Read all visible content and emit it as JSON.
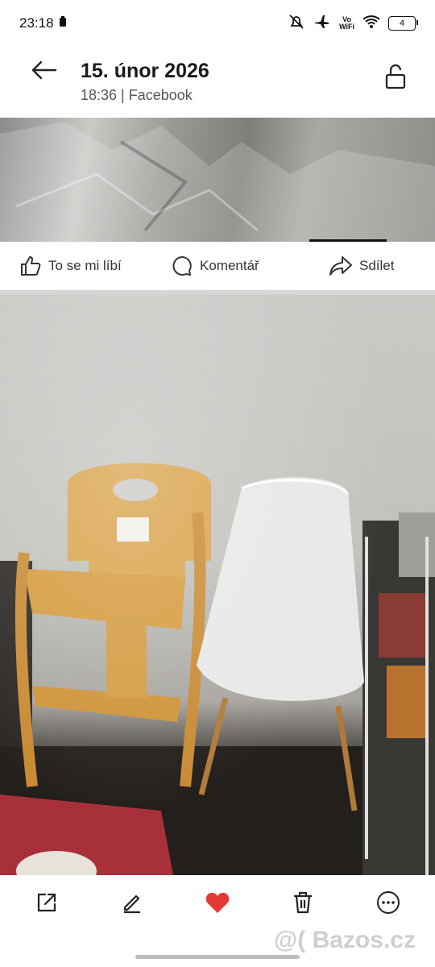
{
  "status_bar": {
    "time": "23:18",
    "vowifi_line1": "Vo",
    "vowifi_line2": "WiFi",
    "battery": "4"
  },
  "header": {
    "title": "15. únor 2026",
    "subtitle": "18:36 | Facebook"
  },
  "facebook_actions": {
    "like": "To se mi líbí",
    "comment": "Komentář",
    "share": "Sdílet"
  },
  "toolbar": {
    "icons": [
      "share-icon",
      "edit-icon",
      "heart-icon",
      "trash-icon",
      "more-icon"
    ],
    "heart_color": "#e53935"
  },
  "watermark": "@( Bazos.cz"
}
